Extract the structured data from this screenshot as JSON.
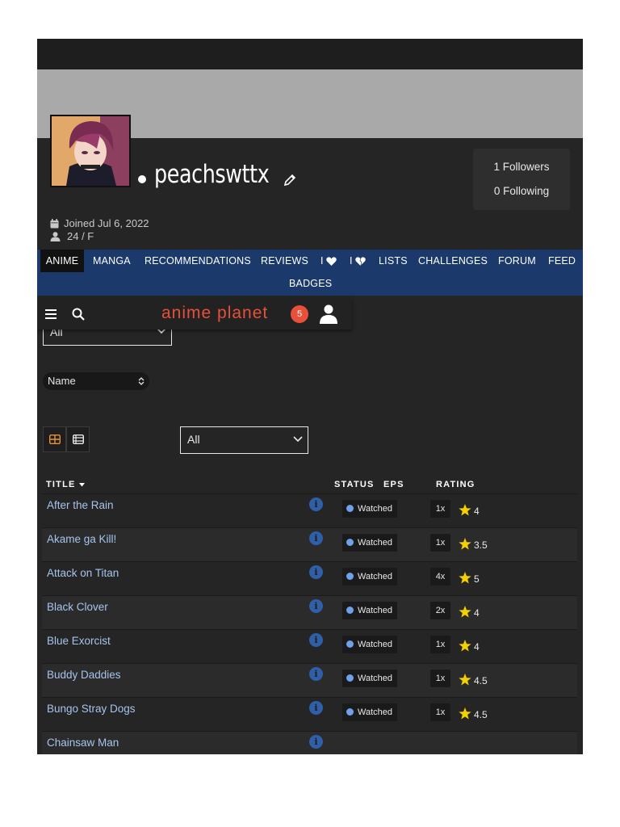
{
  "profile": {
    "username": "peachswttx",
    "followers_label": "1 Followers",
    "following_label": "0 Following",
    "joined": "Joined Jul 6, 2022",
    "age_gender": "24 / F"
  },
  "nav": {
    "items": [
      "ANIME",
      "MANGA",
      "RECOMMENDATIONS",
      "REVIEWS",
      "I",
      "I",
      "LISTS",
      "CHALLENGES",
      "FORUM",
      "FEED"
    ],
    "badges": "BADGES",
    "active": "ANIME"
  },
  "appbar": {
    "logo": "anime planet",
    "notifications": "5"
  },
  "filters": {
    "status_select": "All",
    "sort": "Name",
    "tag_select": "All"
  },
  "table": {
    "headers": {
      "title": "TITLE",
      "status": "STATUS",
      "eps": "EPS",
      "rating": "RATING"
    },
    "rows": [
      {
        "title": "After the Rain",
        "status": "Watched",
        "eps": "1x",
        "rating": "4"
      },
      {
        "title": "Akame ga Kill!",
        "status": "Watched",
        "eps": "1x",
        "rating": "3.5"
      },
      {
        "title": "Attack on Titan",
        "status": "Watched",
        "eps": "4x",
        "rating": "5"
      },
      {
        "title": "Black Clover",
        "status": "Watched",
        "eps": "2x",
        "rating": "4"
      },
      {
        "title": "Blue Exorcist",
        "status": "Watched",
        "eps": "1x",
        "rating": "4"
      },
      {
        "title": "Buddy Daddies",
        "status": "Watched",
        "eps": "1x",
        "rating": "4.5"
      },
      {
        "title": "Bungo Stray Dogs",
        "status": "Watched",
        "eps": "1x",
        "rating": "4.5"
      },
      {
        "title": "Chainsaw Man",
        "status": "",
        "eps": "",
        "rating": ""
      }
    ]
  },
  "colors": {
    "nav_bg": "#1b3a6b",
    "accent": "#e8503a",
    "link": "#a6c4ee",
    "star": "#f5d000"
  }
}
